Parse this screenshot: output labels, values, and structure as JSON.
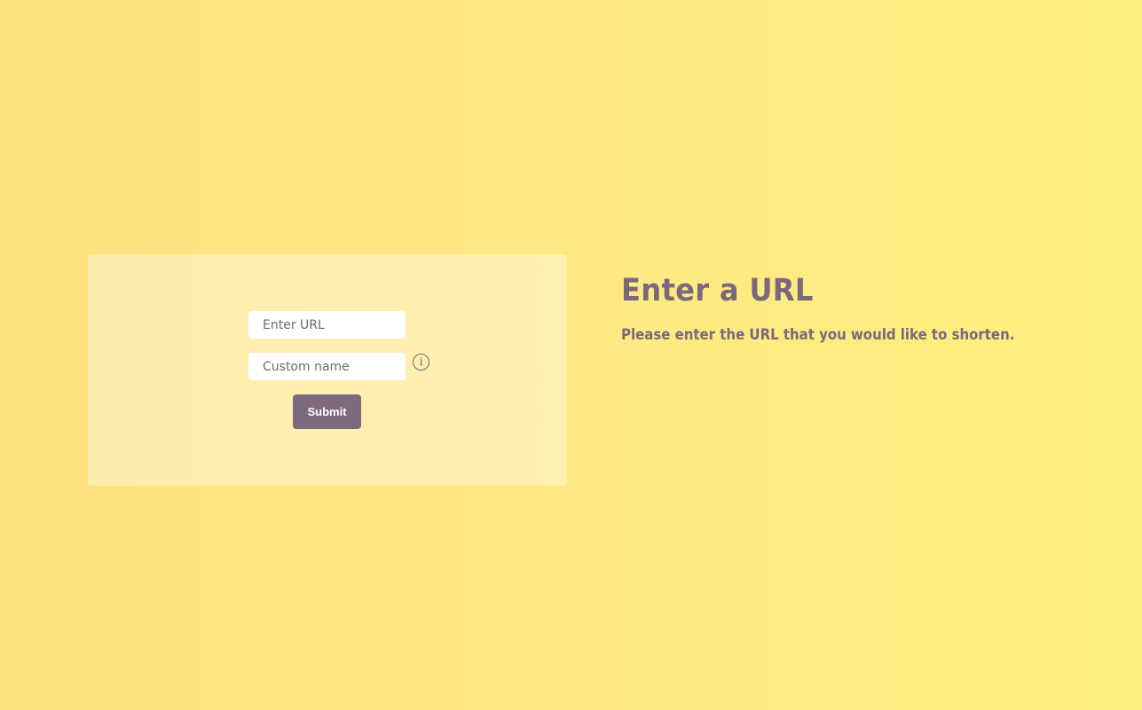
{
  "form": {
    "url_placeholder": "Enter URL",
    "url_value": "",
    "custom_name_placeholder": "Custom name",
    "custom_name_value": "",
    "info_icon": "i",
    "submit_label": "Submit"
  },
  "info": {
    "title": "Enter a URL",
    "description": "Please enter the URL that you would like to shorten."
  },
  "colors": {
    "accent": "#7e6a7e",
    "text": "#7a687c",
    "background": "#ffe882"
  }
}
